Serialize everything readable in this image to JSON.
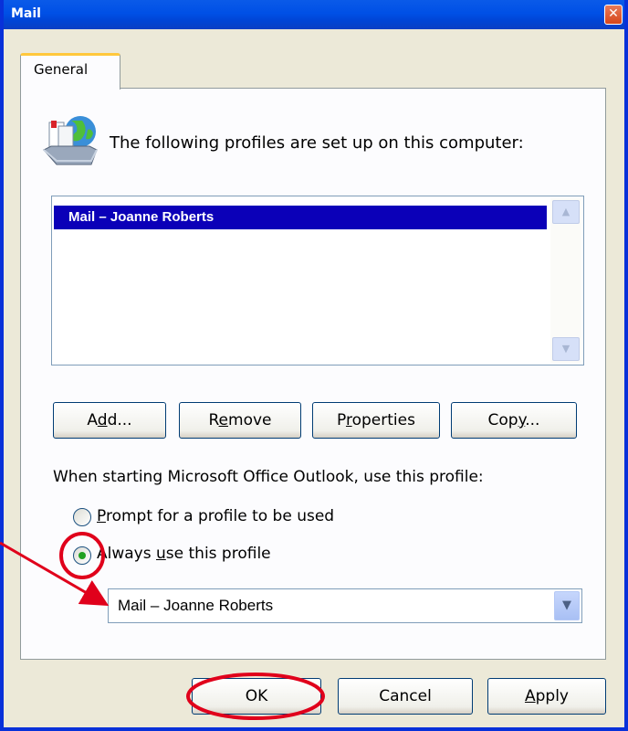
{
  "window": {
    "title": "Mail",
    "close_glyph": "✕"
  },
  "tabs": [
    {
      "label": "General",
      "selected": true
    }
  ],
  "profiles": {
    "intro_text": "The following profiles are set up on this computer:",
    "items": [
      {
        "label": "Mail – Joanne Roberts",
        "selected": true
      }
    ]
  },
  "buttons": {
    "add": {
      "before": "A",
      "accel": "d",
      "after": "d..."
    },
    "remove": {
      "before": "R",
      "accel": "e",
      "after": "move"
    },
    "properties": {
      "before": "P",
      "accel": "r",
      "after": "operties"
    },
    "copy": {
      "before": "Cop",
      "accel": "y",
      "after": "..."
    }
  },
  "startup": {
    "label": "When starting Microsoft Office Outlook, use this profile:",
    "options": [
      {
        "before": "",
        "accel": "P",
        "after": "rompt for a profile to be used",
        "selected": false
      },
      {
        "before": "Always ",
        "accel": "u",
        "after": "se this profile",
        "selected": true
      }
    ],
    "selected_profile": "Mail – Joanne Roberts"
  },
  "footer": {
    "ok": "OK",
    "cancel": "Cancel",
    "apply_accel": "A",
    "apply_after": "pply"
  },
  "icons": {
    "scroll_up": "▲",
    "scroll_down": "▼",
    "dropdown": "▼"
  },
  "colors": {
    "titlebar": "#0054e3",
    "selection": "#0b00b8",
    "annotation": "#e0001b",
    "radio_dot": "#21a121"
  }
}
